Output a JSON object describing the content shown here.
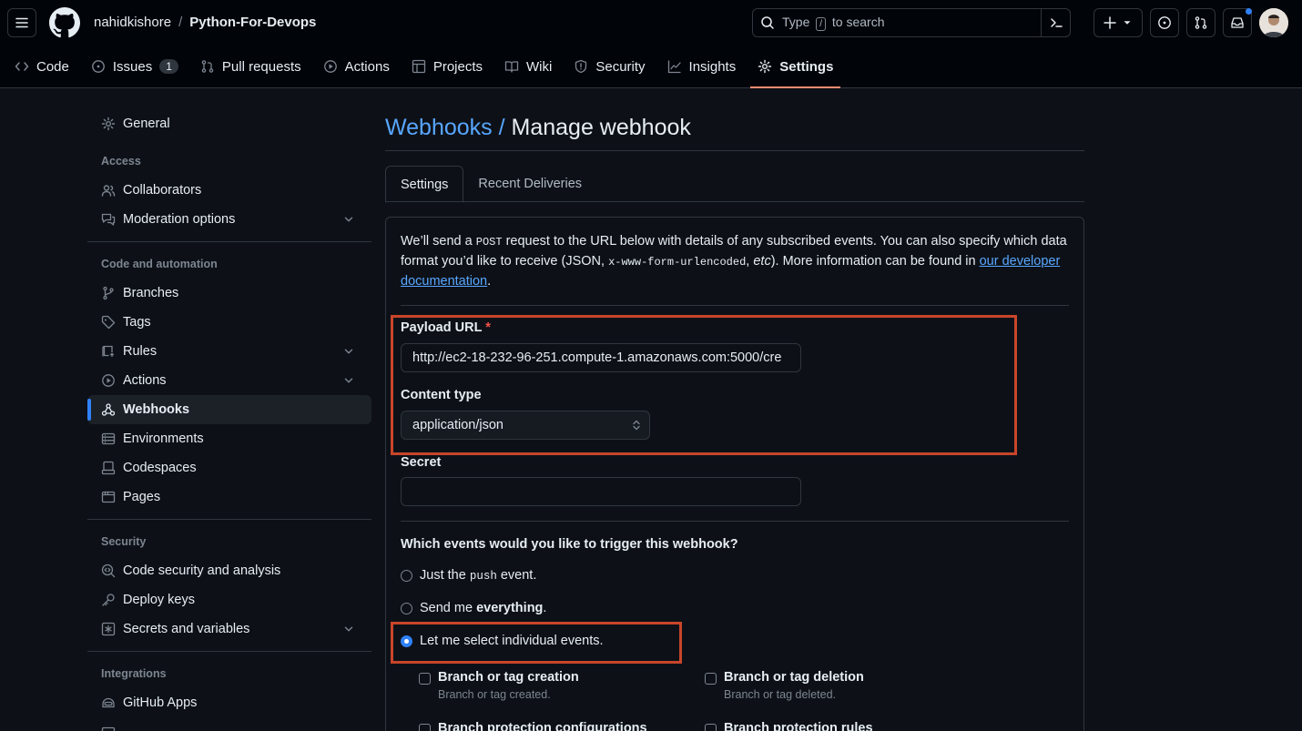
{
  "header": {
    "owner": "nahidkishore",
    "separator": "/",
    "repo": "Python-For-Devops",
    "search": {
      "pre": "Type",
      "key": "/",
      "post": "to search"
    }
  },
  "repo_nav": [
    {
      "label": "Code",
      "icon": "code-icon"
    },
    {
      "label": "Issues",
      "icon": "issue-icon",
      "counter": "1"
    },
    {
      "label": "Pull requests",
      "icon": "pull-request-icon"
    },
    {
      "label": "Actions",
      "icon": "play-icon"
    },
    {
      "label": "Projects",
      "icon": "table-icon"
    },
    {
      "label": "Wiki",
      "icon": "book-icon"
    },
    {
      "label": "Security",
      "icon": "shield-icon"
    },
    {
      "label": "Insights",
      "icon": "graph-icon"
    },
    {
      "label": "Settings",
      "icon": "gear-icon",
      "active": true
    }
  ],
  "sidebar": {
    "general": "General",
    "access_heading": "Access",
    "collaborators": "Collaborators",
    "moderation": "Moderation options",
    "code_heading": "Code and automation",
    "branches": "Branches",
    "tags": "Tags",
    "rules": "Rules",
    "actions": "Actions",
    "webhooks": "Webhooks",
    "environments": "Environments",
    "codespaces": "Codespaces",
    "pages": "Pages",
    "security_heading": "Security",
    "code_security": "Code security and analysis",
    "deploy_keys": "Deploy keys",
    "secrets": "Secrets and variables",
    "integrations_heading": "Integrations",
    "github_apps": "GitHub Apps"
  },
  "main": {
    "title_link": "Webhooks /",
    "title_rest": "Manage webhook",
    "tabs": [
      "Settings",
      "Recent Deliveries"
    ],
    "intro": {
      "p1": "We’ll send a ",
      "code1": "POST",
      "p2": " request to the URL below with details of any subscribed events. You can also specify which data format you’d like to receive (JSON, ",
      "code2": "x-www-form-urlencoded",
      "p3": ", ",
      "etc": "etc",
      "p4": "). More information can be found in ",
      "link": "our developer documentation",
      "p5": "."
    },
    "payload_label": "Payload URL",
    "required_mark": "*",
    "payload_value": "http://ec2-18-232-96-251.compute-1.amazonaws.com:5000/cre",
    "content_type_label": "Content type",
    "content_type_value": "application/json",
    "secret_label": "Secret",
    "secret_value": "",
    "events_question": "Which events would you like to trigger this webhook?",
    "radio_push_pre": "Just the ",
    "radio_push_code": "push",
    "radio_push_post": " event.",
    "radio_all_pre": "Send me ",
    "radio_all_bold": "everything",
    "radio_all_post": ".",
    "radio_individual": "Let me select individual events.",
    "events": [
      {
        "title": "Branch or tag creation",
        "desc": "Branch or tag created."
      },
      {
        "title": "Branch or tag deletion",
        "desc": "Branch or tag deleted."
      },
      {
        "title": "Branch protection configurations",
        "desc": ""
      },
      {
        "title": "Branch protection rules",
        "desc": ""
      }
    ]
  },
  "colors": {
    "accent": "#2f81f7",
    "highlight": "#c9452a",
    "link": "#58a6ff",
    "tab_underline": "#fd8c73"
  }
}
